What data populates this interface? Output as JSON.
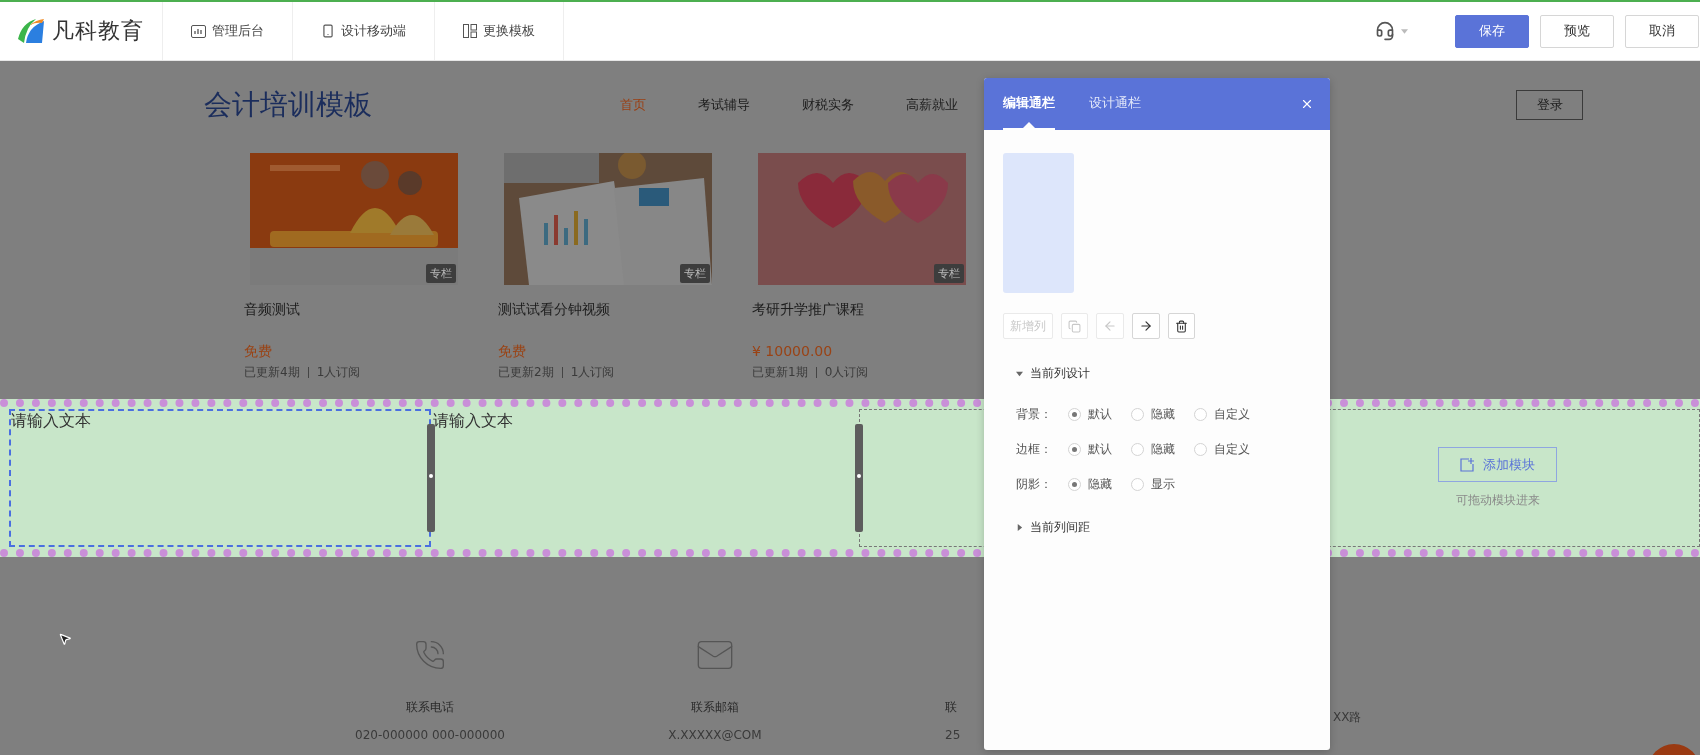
{
  "topbar": {
    "logo": "凡科教育",
    "nav": [
      {
        "kind": "chart",
        "label": "管理后台"
      },
      {
        "kind": "mobile",
        "label": "设计移动端"
      },
      {
        "kind": "template",
        "label": "更换模板"
      }
    ],
    "buttons": [
      {
        "kind": "primary",
        "label": "保存"
      },
      {
        "kind": "default",
        "label": "预览"
      },
      {
        "kind": "default",
        "label": "取消"
      }
    ]
  },
  "site": {
    "title": "会计培训模板",
    "nav": [
      {
        "label": "首页",
        "selected": true
      },
      {
        "label": "考试辅导",
        "selected": false
      },
      {
        "label": "财税实务",
        "selected": false
      },
      {
        "label": "高薪就业",
        "selected": false
      }
    ],
    "login": "登录"
  },
  "courses": [
    {
      "image": {
        "kind": "picture"
      },
      "badge": "专栏",
      "title": "音频测试",
      "price": "免费",
      "meta": [
        "已更新4期",
        "1人订阅"
      ]
    },
    {
      "image": {
        "kind": "picture"
      },
      "badge": "专栏",
      "title": "测试试看分钟视频",
      "price": "免费",
      "meta": [
        "已更新2期",
        "1人订阅"
      ]
    },
    {
      "image": {
        "kind": "picture"
      },
      "badge": "专栏",
      "title": "考研升学推广课程",
      "price": "¥ 10000.00",
      "meta": [
        "已更新1期",
        "0人订阅"
      ]
    }
  ],
  "band": {
    "columns": [
      {
        "kind": "text",
        "text": "请输入文本",
        "selected": true
      },
      {
        "kind": "text",
        "text": "请输入文本",
        "selected": false
      },
      {
        "kind": "empty",
        "button": "添加模块",
        "hint": "可拖动模块进来",
        "selected": false
      }
    ]
  },
  "footer": [
    {
      "kind": "phone",
      "title": "联系电话",
      "value": "020-000000 000-000000"
    },
    {
      "kind": "mail",
      "title": "联系邮箱",
      "value": "X.XXXXX@COM"
    },
    {
      "title": "联",
      "value": "25"
    },
    {
      "value": "XX路"
    }
  ],
  "panel": {
    "tabs": [
      {
        "label": "编辑通栏",
        "selected": true
      },
      {
        "label": "设计通栏",
        "selected": false
      }
    ],
    "tools": [
      {
        "kind": "add",
        "label": "新增列",
        "disabled": true
      },
      {
        "kind": "copy",
        "disabled": true
      },
      {
        "kind": "left",
        "disabled": true
      },
      {
        "kind": "right",
        "disabled": false
      },
      {
        "kind": "delete",
        "disabled": false
      }
    ],
    "sections": [
      {
        "label": "当前列设计",
        "expanded": true,
        "rows": [
          {
            "label": "背景：",
            "options": [
              {
                "label": "默认",
                "selected": true
              },
              {
                "label": "隐藏",
                "selected": false
              },
              {
                "label": "自定义",
                "selected": false
              }
            ]
          },
          {
            "label": "边框：",
            "options": [
              {
                "label": "默认",
                "selected": true
              },
              {
                "label": "隐藏",
                "selected": false
              },
              {
                "label": "自定义",
                "selected": false
              }
            ]
          },
          {
            "label": "阴影：",
            "options": [
              {
                "label": "隐藏",
                "selected": true
              },
              {
                "label": "显示",
                "selected": false
              }
            ]
          }
        ]
      },
      {
        "label": "当前列间距",
        "expanded": false
      }
    ]
  }
}
